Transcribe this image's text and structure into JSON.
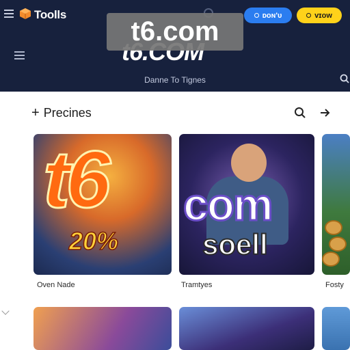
{
  "header": {
    "brand": "Toolls",
    "login_label": "ᴅᴏɴ'ᴜ",
    "signup_label": "ᴠɪᴏᴡ",
    "watermark": "t6.com",
    "site_logo": "t6.COM",
    "tagline": "Danne To Tignes"
  },
  "section": {
    "title": "Precines"
  },
  "cards": [
    {
      "headline": "t6",
      "promo": "20%",
      "caption": "Oven Nade"
    },
    {
      "headline": "com",
      "subline": "soell",
      "caption": "Tramtyes"
    },
    {
      "caption": "Fosty"
    }
  ],
  "colors": {
    "header_bg": "#17213d",
    "login_button": "#2b7df0",
    "signup_button": "#ffd21a"
  },
  "icons": [
    "menu-icon",
    "cube-logo-icon",
    "search-icon",
    "arrow-right-icon",
    "plus-icon",
    "chevron-left-icon"
  ]
}
